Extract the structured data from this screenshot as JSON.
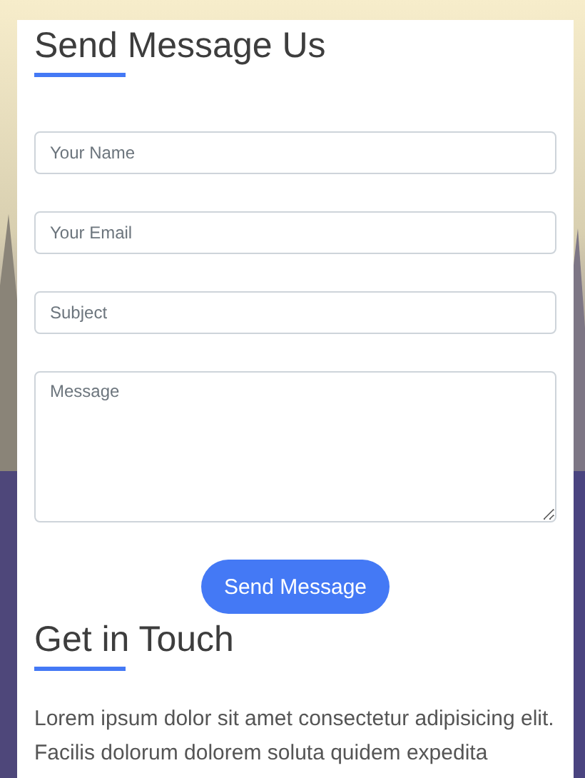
{
  "contact_form": {
    "title": "Send Message Us",
    "fields": [
      {
        "kind": "input",
        "placeholder": "Your Name"
      },
      {
        "kind": "input",
        "placeholder": "Your Email"
      },
      {
        "kind": "input",
        "placeholder": "Subject"
      },
      {
        "kind": "textarea",
        "placeholder": "Message"
      }
    ],
    "submit": "Send Message"
  },
  "get_in_touch": {
    "title": "Get in Touch",
    "text": "Lorem ipsum dolor sit amet consectetur adipisicing elit. Facilis dolorum dolorem soluta quidem expedita"
  }
}
